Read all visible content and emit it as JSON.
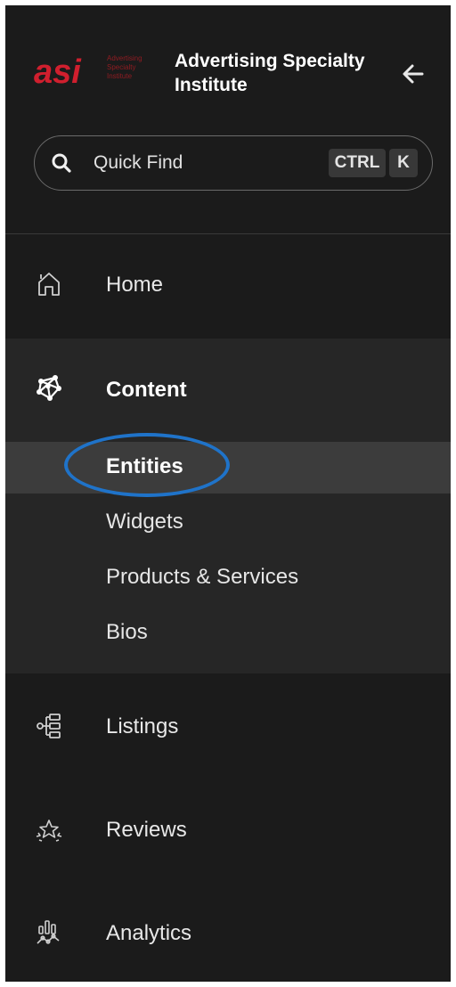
{
  "header": {
    "logo_text": "asi",
    "logo_tagline": [
      "Advertising",
      "Specialty",
      "Institute"
    ],
    "brand_line1": "Advertising Specialty",
    "brand_line2": "Institute"
  },
  "search": {
    "placeholder": "Quick Find",
    "shortcut_key1": "CTRL",
    "shortcut_key2": "K"
  },
  "nav": {
    "home": {
      "label": "Home",
      "icon": "home-icon"
    },
    "content": {
      "label": "Content",
      "icon": "network-nodes-icon",
      "items": [
        {
          "label": "Entities",
          "active": true
        },
        {
          "label": "Widgets"
        },
        {
          "label": "Products & Services"
        },
        {
          "label": "Bios"
        }
      ]
    },
    "listings": {
      "label": "Listings",
      "icon": "listings-tree-icon"
    },
    "reviews": {
      "label": "Reviews",
      "icon": "stars-icon"
    },
    "analytics": {
      "label": "Analytics",
      "icon": "analytics-chart-icon"
    }
  },
  "colors": {
    "sidebar_bg": "#1b1b1b",
    "group_bg": "#262626",
    "active_bg": "#3c3c3c",
    "brand_red": "#d01f2e",
    "highlight": "#1f73c9"
  }
}
